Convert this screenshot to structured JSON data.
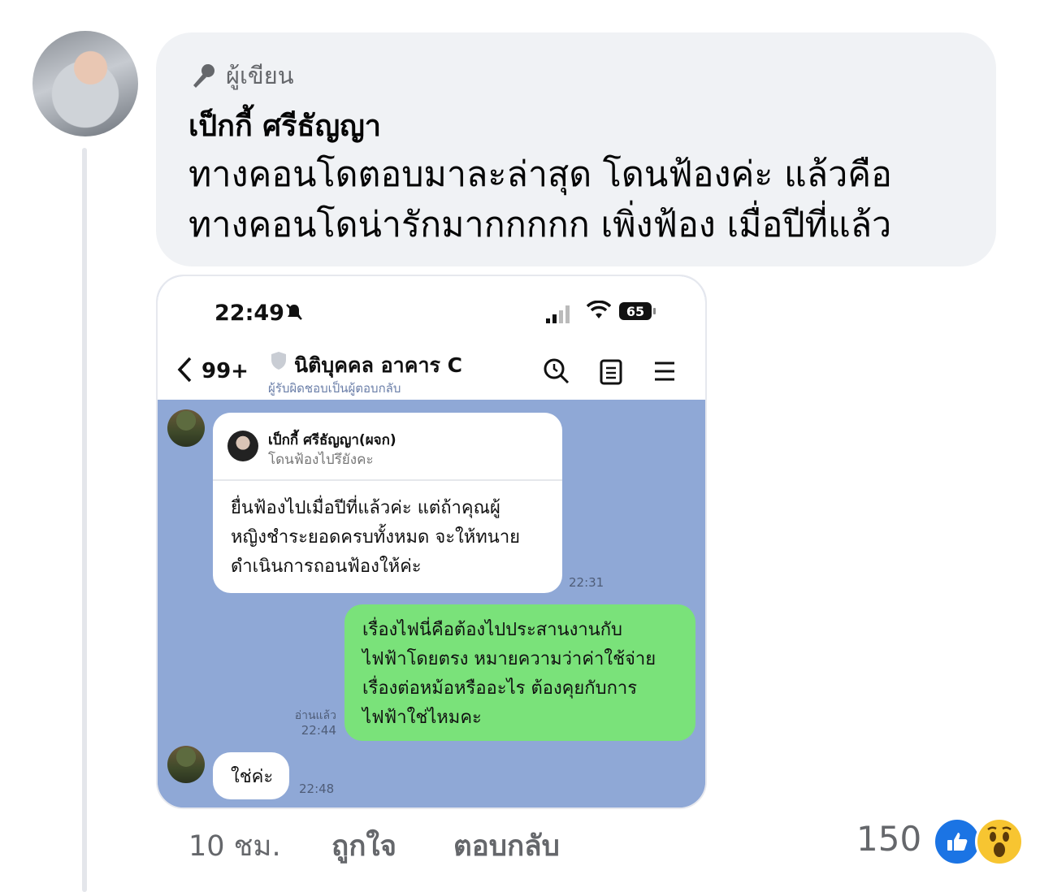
{
  "comment": {
    "author_badge": "ผู้เขียน",
    "author_name": "เป็กกี้ ศรีธัญญา",
    "text_line1": "ทางคอนโดตอบมาละล่าสุด โดนฟ้องค่ะ แล้วคือ",
    "text_line2": "ทางคอนโดน่ารักมากกกกก เพิ่งฟ้อง  เมื่อปีที่แล้ว"
  },
  "phone": {
    "status_time": "22:49",
    "battery": "65",
    "back_count": "99+",
    "chat_title": "นิติบุคคล อาคาร C",
    "chat_subtitle": "ผู้รับผิดชอบเป็นผู้ตอบกลับ",
    "messages": [
      {
        "quote_name": "เป็กกี้ ศรีธัญญา(ผจก)",
        "quote_text": "โดนฟ้องไปรึยังคะ",
        "line1": "ยื่นฟ้องไปเมื่อปีที่แล้วค่ะ แต่ถ้าคุณผู้",
        "line2": "หญิงชำระยอดครบทั้งหมด จะให้ทนาย",
        "line3": "ดำเนินการถอนฟ้องให้ค่ะ",
        "time": "22:31"
      },
      {
        "line1": "เรื่องไฟนี่คือต้องไปประสานงานกับ",
        "line2": "ไฟฟ้าโดยตรง หมายความว่าค่าใช้จ่าย",
        "line3": "เรื่องต่อหม้อหรืออะไร ต้องคุยกับการ",
        "line4": "ไฟฟ้าใช่ไหมคะ",
        "read": "อ่านแล้ว",
        "time": "22:44"
      },
      {
        "text": "ใช่ค่ะ",
        "time": "22:48"
      }
    ]
  },
  "footer": {
    "time_ago": "10 ชม.",
    "like_label": "ถูกใจ",
    "reply_label": "ตอบกลับ",
    "reaction_count": "150"
  },
  "colors": {
    "bubble_bg": "#f0f2f5",
    "chat_bg": "#8fa8d6",
    "green_bubble": "#7ae27a",
    "like_blue": "#1b74e4",
    "wow_yellow": "#f7c531"
  }
}
